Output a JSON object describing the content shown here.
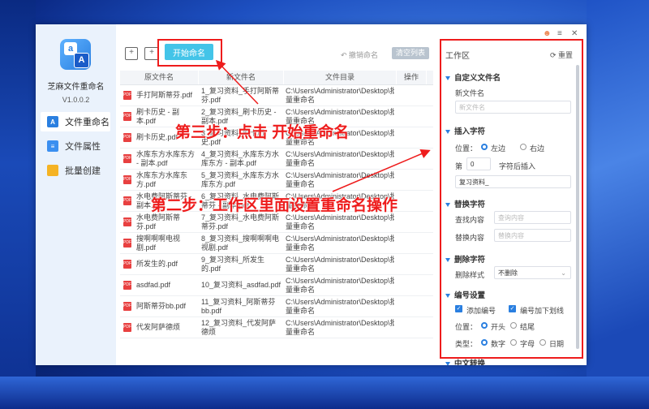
{
  "app": {
    "name": "芝麻文件重命名",
    "version": "V1.0.0.2"
  },
  "sidebar": {
    "items": [
      {
        "label": "文件重命名",
        "icon": "rename-icon",
        "color": "#2a7fe0"
      },
      {
        "label": "文件属性",
        "icon": "file-attr-icon",
        "color": "#3b8ff0"
      },
      {
        "label": "批量创建",
        "icon": "folder-icon",
        "color": "#f5b324"
      }
    ]
  },
  "toolbar": {
    "start": "开始命名",
    "undo": "撤销命名",
    "clear": "清空列表"
  },
  "table": {
    "headers": [
      "原文件名",
      "新文件名",
      "文件目录",
      "操作"
    ],
    "rows": [
      {
        "orig": "手打阿斯蒂芬.pdf",
        "new": "1_复习资料_手打阿斯蒂芬.pdf",
        "dir": "C:\\Users\\Administrator\\Desktop\\批量重命名"
      },
      {
        "orig": "刷卡历史 - 副本.pdf",
        "new": "2_复习资料_刷卡历史 - 副本.pdf",
        "dir": "C:\\Users\\Administrator\\Desktop\\批量重命名"
      },
      {
        "orig": "刷卡历史.pdf",
        "new": "3_复习资料_刷卡历史.pdf",
        "dir": "C:\\Users\\Administrator\\Desktop\\批量重命名"
      },
      {
        "orig": "水库东方水库东方 - 副本.pdf",
        "new": "4_复习资料_水库东方水库东方 - 副本.pdf",
        "dir": "C:\\Users\\Administrator\\Desktop\\批量重命名"
      },
      {
        "orig": "水库东方水库东方.pdf",
        "new": "5_复习资料_水库东方水库东方.pdf",
        "dir": "C:\\Users\\Administrator\\Desktop\\批量重命名"
      },
      {
        "orig": "水电费阿斯蒂芬 - 副本.pdf",
        "new": "6_复习资料_水电费阿斯蒂芬 - 副本.pdf",
        "dir": "C:\\Users\\Administrator\\Desktop\\批量重命名"
      },
      {
        "orig": "水电费阿斯蒂芬.pdf",
        "new": "7_复习资料_水电费阿斯蒂芬.pdf",
        "dir": "C:\\Users\\Administrator\\Desktop\\批量重命名"
      },
      {
        "orig": "搜啊啊啊电视剧.pdf",
        "new": "8_复习资料_搜啊啊啊电视剧.pdf",
        "dir": "C:\\Users\\Administrator\\Desktop\\批量重命名"
      },
      {
        "orig": "所发生的.pdf",
        "new": "9_复习资料_所发生的.pdf",
        "dir": "C:\\Users\\Administrator\\Desktop\\批量重命名"
      },
      {
        "orig": "asdfad.pdf",
        "new": "10_复习资料_asdfad.pdf",
        "dir": "C:\\Users\\Administrator\\Desktop\\批量重命名"
      },
      {
        "orig": "阿斯蒂芬bb.pdf",
        "new": "11_复习资料_阿斯蒂芬bb.pdf",
        "dir": "C:\\Users\\Administrator\\Desktop\\批量重命名"
      },
      {
        "orig": "代发阿萨德烦",
        "new": "12_复习资料_代发阿萨德烦",
        "dir": "C:\\Users\\Administrator\\Desktop\\批量重命名"
      }
    ]
  },
  "work": {
    "title": "工作区",
    "reset": "重置",
    "custom": {
      "section": "自定义文件名",
      "label": "新文件名",
      "placeholder": "新文件名"
    },
    "insert": {
      "section": "插入字符",
      "pos_label": "位置：",
      "left": "左边",
      "right": "右边",
      "pre": "第",
      "num": "0",
      "post": "字符后插入",
      "value": "复习资料_"
    },
    "replace": {
      "section": "替换字符",
      "find": "查找内容",
      "find_ph": "查询内容",
      "repl": "替换内容",
      "repl_ph": "替换内容"
    },
    "delete": {
      "section": "删除字符",
      "style_label": "删除样式",
      "style": "不删除"
    },
    "number": {
      "section": "编号设置",
      "add": "添加编号",
      "underline": "编号加下划线",
      "pos_label": "位置：",
      "start": "开头",
      "end": "结尾",
      "type_label": "类型：",
      "t1": "数字",
      "t2": "字母",
      "t3": "日期"
    },
    "next_section": "中文转换"
  },
  "annotations": {
    "step3": "第三步：点击 开始重命名",
    "step2": "第二步：工作区里面设置重命名操作"
  },
  "colors": {
    "accent": "#2a7fe0",
    "start_button": "#43c4e8",
    "annotation": "#ee1c1c"
  }
}
